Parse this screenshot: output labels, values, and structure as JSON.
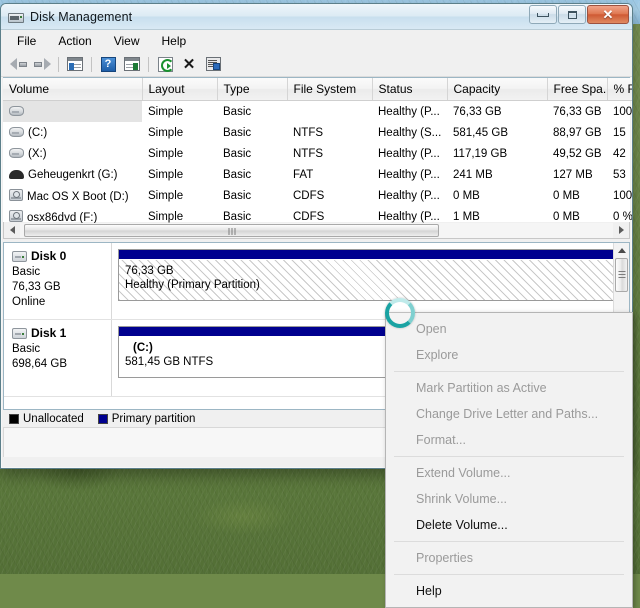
{
  "window": {
    "title": "Disk Management",
    "icon": "disk-management-icon",
    "controls": {
      "minimize": "–",
      "maximize": "□",
      "close": "✕"
    }
  },
  "menubar": {
    "items": [
      "File",
      "Action",
      "View",
      "Help"
    ]
  },
  "toolbar": {
    "items": [
      "back-arrow-icon",
      "forward-arrow-icon",
      "separator",
      "show-console-tree-icon",
      "separator",
      "help-icon",
      "show-action-pane-icon",
      "separator",
      "refresh-icon",
      "delete-icon",
      "rescan-disks-icon"
    ],
    "help_glyph": "?",
    "delete_glyph": "✕"
  },
  "volume_list": {
    "columns": [
      "Volume",
      "Layout",
      "Type",
      "File System",
      "Status",
      "Capacity",
      "Free Spa...",
      "% F"
    ],
    "rows": [
      {
        "selected": true,
        "icon": "hard-disk-icon",
        "volume": "",
        "layout": "Simple",
        "type": "Basic",
        "filesystem": "",
        "status": "Healthy (P...",
        "capacity": "76,33 GB",
        "free": "76,33 GB",
        "percent": "100"
      },
      {
        "selected": false,
        "icon": "hard-disk-icon",
        "volume": "(C:)",
        "layout": "Simple",
        "type": "Basic",
        "filesystem": "NTFS",
        "status": "Healthy (S...",
        "capacity": "581,45 GB",
        "free": "88,97 GB",
        "percent": "15"
      },
      {
        "selected": false,
        "icon": "hard-disk-icon",
        "volume": "(X:)",
        "layout": "Simple",
        "type": "Basic",
        "filesystem": "NTFS",
        "status": "Healthy (P...",
        "capacity": "117,19 GB",
        "free": "49,52 GB",
        "percent": "42"
      },
      {
        "selected": false,
        "icon": "usb-drive-icon",
        "volume": "Geheugenkrt (G:)",
        "layout": "Simple",
        "type": "Basic",
        "filesystem": "FAT",
        "status": "Healthy (P...",
        "capacity": "241 MB",
        "free": "127 MB",
        "percent": "53"
      },
      {
        "selected": false,
        "icon": "cd-drive-icon",
        "volume": "Mac OS X Boot (D:)",
        "layout": "Simple",
        "type": "Basic",
        "filesystem": "CDFS",
        "status": "Healthy (P...",
        "capacity": "0 MB",
        "free": "0 MB",
        "percent": "100"
      },
      {
        "selected": false,
        "icon": "cd-drive-icon",
        "volume": "osx86dvd (F:)",
        "layout": "Simple",
        "type": "Basic",
        "filesystem": "CDFS",
        "status": "Healthy (P...",
        "capacity": "1 MB",
        "free": "0 MB",
        "percent": "0 %"
      }
    ]
  },
  "disk_pane": {
    "disks": [
      {
        "name": "Disk 0",
        "type": "Basic",
        "size": "76,33 GB",
        "state": "Online",
        "partition": {
          "line1": "76,33 GB",
          "line2": "Healthy (Primary Partition)",
          "hatched": true,
          "indent": false
        }
      },
      {
        "name": "Disk 1",
        "type": "Basic",
        "size": "698,64 GB",
        "state": "",
        "partition": {
          "line1": "(C:)",
          "line2": "581,45 GB NTFS",
          "hatched": false,
          "indent": true
        }
      }
    ],
    "legend": [
      {
        "label": "Unallocated",
        "color": "#000000"
      },
      {
        "label": "Primary partition",
        "color": "#00008f"
      }
    ]
  },
  "context_menu": {
    "items": [
      {
        "label": "Open",
        "enabled": false
      },
      {
        "label": "Explore",
        "enabled": false
      },
      {
        "label": "__sep__",
        "enabled": false
      },
      {
        "label": "Mark Partition as Active",
        "enabled": false
      },
      {
        "label": "Change Drive Letter and Paths...",
        "enabled": false
      },
      {
        "label": "Format...",
        "enabled": false
      },
      {
        "label": "__sep__",
        "enabled": false
      },
      {
        "label": "Extend Volume...",
        "enabled": false
      },
      {
        "label": "Shrink Volume...",
        "enabled": false
      },
      {
        "label": "Delete Volume...",
        "enabled": true
      },
      {
        "label": "__sep__",
        "enabled": false
      },
      {
        "label": "Properties",
        "enabled": false
      },
      {
        "label": "__sep__",
        "enabled": false
      },
      {
        "label": "Help",
        "enabled": true
      }
    ]
  },
  "cursor": {
    "type": "busy-spinner-cursor"
  },
  "colors": {
    "primary_partition": "#00008f",
    "unallocated": "#000000",
    "title_accent": "#c6deee",
    "close_button": "#cf5a34"
  }
}
